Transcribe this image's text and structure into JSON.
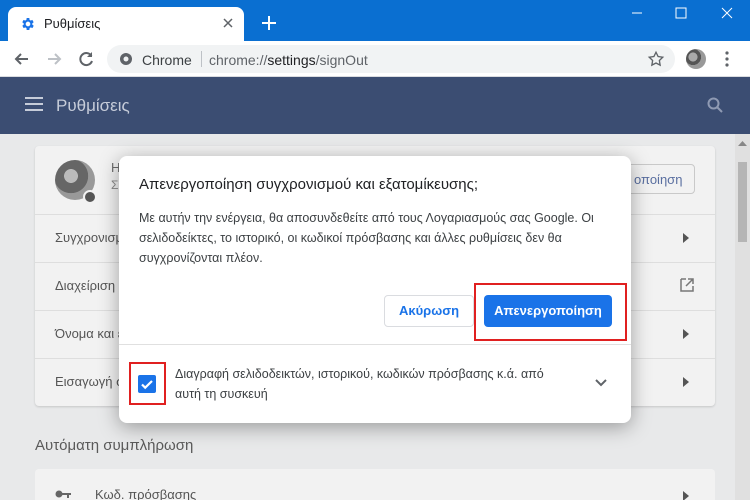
{
  "browser": {
    "tab": {
      "title": "Ρυθμίσεις",
      "icon": "settings-gear-icon"
    },
    "omnibox": {
      "scheme_label": "Chrome",
      "url_prefix": "chrome://",
      "url_path": "settings",
      "url_suffix": "/signOut"
    }
  },
  "settings": {
    "header_title": "Ρυθμίσεις",
    "profile": {
      "name": "Η",
      "subtitle": "Σ",
      "turnoff_button": "οποίηση"
    },
    "rows": [
      "Συγχρονισμ",
      "Διαχείριση",
      "Όνομα και ε",
      "Εισαγωγή σ"
    ],
    "autofill_section": "Αυτόματη συμπλήρωση",
    "autofill_item": "Κωδ. πρόσβασης"
  },
  "dialog": {
    "title": "Απενεργοποίηση συγχρονισμού και εξατομίκευσης;",
    "body": "Με αυτήν την ενέργεια, θα αποσυνδεθείτε από τους Λογαριασμούς σας Google. Οι σελιδοδείκτες, το ιστορικό, οι κωδικοί πρόσβασης και άλλες ρυθμίσεις δεν θα συγχρονίζονται πλέον.",
    "cancel_label": "Ακύρωση",
    "turnoff_label": "Απενεργοποίηση",
    "checkbox_label": "Διαγραφή σελιδοδεικτών, ιστορικού, κωδικών πρόσβασης κ.ά. από αυτή τη συσκευή",
    "checkbox_checked": true
  },
  "colors": {
    "titlebar": "#0a6fd1",
    "accent": "#1a73e8",
    "header": "#3b4d72",
    "highlight": "#e02020"
  }
}
